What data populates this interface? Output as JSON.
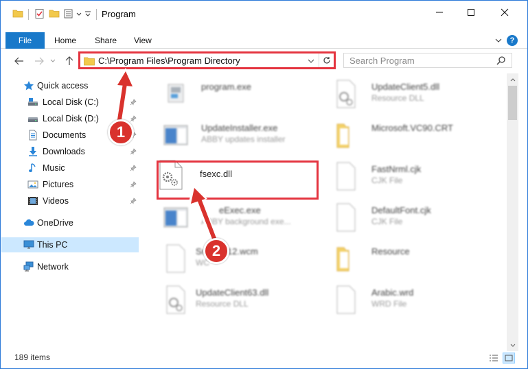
{
  "window": {
    "title": "Program"
  },
  "ribbon": {
    "file_tab": "File",
    "tabs": [
      "Home",
      "Share",
      "View"
    ],
    "help": "?"
  },
  "address": {
    "path": "C:\\Program Files\\Program Directory",
    "search_placeholder": "Search Program"
  },
  "nav": {
    "items": [
      {
        "label": "Quick access",
        "icon": "star-icon"
      },
      {
        "label": "Local Disk (C:)",
        "icon": "drive-icon",
        "pinned": true
      },
      {
        "label": "Local Disk (D:)",
        "icon": "drive-icon",
        "pinned": true
      },
      {
        "label": "Documents",
        "icon": "documents-icon",
        "pinned": true
      },
      {
        "label": "Downloads",
        "icon": "download-icon",
        "pinned": true
      },
      {
        "label": "Music",
        "icon": "music-icon",
        "pinned": true
      },
      {
        "label": "Pictures",
        "icon": "pictures-icon",
        "pinned": true
      },
      {
        "label": "Videos",
        "icon": "videos-icon",
        "pinned": true
      },
      {
        "label": "OneDrive",
        "icon": "cloud-icon"
      },
      {
        "label": "This PC",
        "icon": "computer-icon",
        "selected": true
      },
      {
        "label": "Network",
        "icon": "network-icon"
      }
    ]
  },
  "files": [
    {
      "name": "program.exe",
      "type": ""
    },
    {
      "name": "UpdateClient5.dll",
      "type": "Resource DLL"
    },
    {
      "name": "UpdateInstaller.exe",
      "type": "ABBY updates installer"
    },
    {
      "name": "Microsoft.VC90.CRT",
      "type": ""
    },
    {
      "name": "fsexc.dll",
      "type": ""
    },
    {
      "name": "FastNrml.cjk",
      "type": "CJK File"
    },
    {
      "name": "eExec.exe",
      "type": "ABBY background exe..."
    },
    {
      "name": "DefaultFont.cjk",
      "type": "CJK File"
    },
    {
      "name": "Sn",
      "name2": "12.wcm",
      "type": "WC"
    },
    {
      "name": "Resource",
      "type": ""
    },
    {
      "name": "UpdateClient63.dll",
      "type": "Resource DLL"
    },
    {
      "name": "Arabic.wrd",
      "type": "WRD File"
    }
  ],
  "callouts": [
    "1",
    "2"
  ],
  "status": {
    "item_count": "189 items"
  },
  "colors": {
    "accent": "#1979ca",
    "highlight_red": "#e4343f",
    "badge_red": "#d9322d",
    "selection": "#cce8ff"
  }
}
